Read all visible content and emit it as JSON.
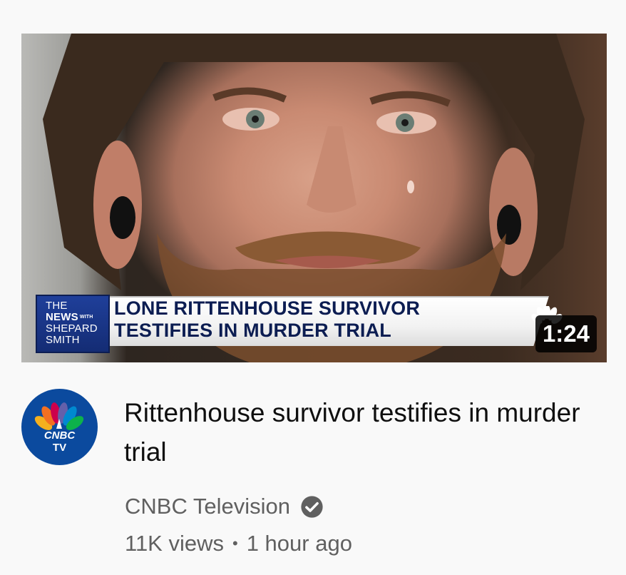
{
  "thumbnail": {
    "show_logo": {
      "line1": "THE",
      "line2": "NEWS",
      "with": "WITH",
      "line3": "SHEPARD",
      "line4": "SMITH"
    },
    "headline": {
      "line1": "LONE RITTENHOUSE SURVIVOR",
      "line2": "TESTIFIES IN MURDER TRIAL"
    },
    "duration": "1:24"
  },
  "channel": {
    "avatar_text_line1": "CNBC",
    "avatar_text_line2": "TV",
    "name": "CNBC Television",
    "verified": true
  },
  "video": {
    "title": "Rittenhouse survivor testifies in murder trial",
    "views": "11K views",
    "separator": "•",
    "age": "1 hour ago"
  },
  "colors": {
    "background": "#f9f9f9",
    "title": "#0f0f0f",
    "meta": "#606060",
    "avatar_bg": "#0b4a9e",
    "chyron_blue": "#1f3f9a"
  },
  "icons": [
    "nbc-peacock-icon",
    "verified-check-icon"
  ]
}
